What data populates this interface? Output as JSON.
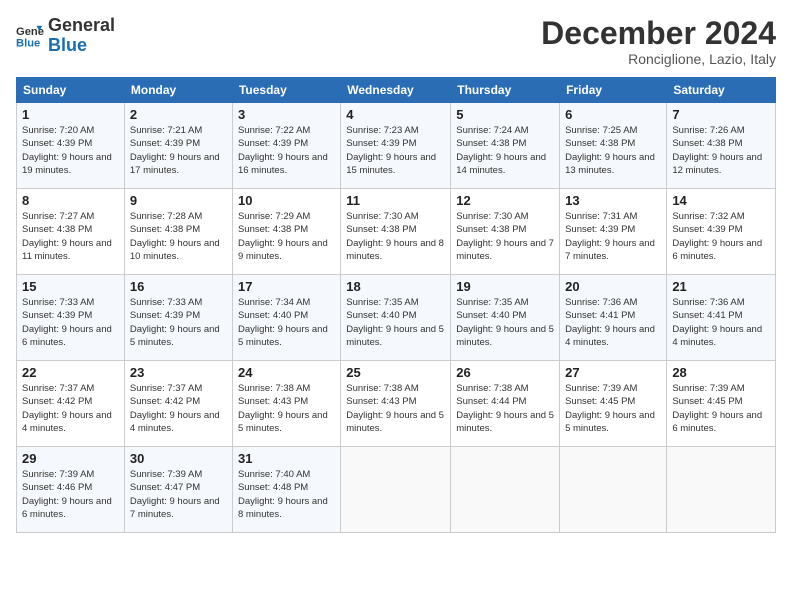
{
  "logo": {
    "line1": "General",
    "line2": "Blue"
  },
  "title": "December 2024",
  "location": "Ronciglione, Lazio, Italy",
  "days_header": [
    "Sunday",
    "Monday",
    "Tuesday",
    "Wednesday",
    "Thursday",
    "Friday",
    "Saturday"
  ],
  "weeks": [
    [
      {
        "day": "1",
        "sunrise": "7:20 AM",
        "sunset": "4:39 PM",
        "daylight": "9 hours and 19 minutes."
      },
      {
        "day": "2",
        "sunrise": "7:21 AM",
        "sunset": "4:39 PM",
        "daylight": "9 hours and 17 minutes."
      },
      {
        "day": "3",
        "sunrise": "7:22 AM",
        "sunset": "4:39 PM",
        "daylight": "9 hours and 16 minutes."
      },
      {
        "day": "4",
        "sunrise": "7:23 AM",
        "sunset": "4:39 PM",
        "daylight": "9 hours and 15 minutes."
      },
      {
        "day": "5",
        "sunrise": "7:24 AM",
        "sunset": "4:38 PM",
        "daylight": "9 hours and 14 minutes."
      },
      {
        "day": "6",
        "sunrise": "7:25 AM",
        "sunset": "4:38 PM",
        "daylight": "9 hours and 13 minutes."
      },
      {
        "day": "7",
        "sunrise": "7:26 AM",
        "sunset": "4:38 PM",
        "daylight": "9 hours and 12 minutes."
      }
    ],
    [
      {
        "day": "8",
        "sunrise": "7:27 AM",
        "sunset": "4:38 PM",
        "daylight": "9 hours and 11 minutes."
      },
      {
        "day": "9",
        "sunrise": "7:28 AM",
        "sunset": "4:38 PM",
        "daylight": "9 hours and 10 minutes."
      },
      {
        "day": "10",
        "sunrise": "7:29 AM",
        "sunset": "4:38 PM",
        "daylight": "9 hours and 9 minutes."
      },
      {
        "day": "11",
        "sunrise": "7:30 AM",
        "sunset": "4:38 PM",
        "daylight": "9 hours and 8 minutes."
      },
      {
        "day": "12",
        "sunrise": "7:30 AM",
        "sunset": "4:38 PM",
        "daylight": "9 hours and 7 minutes."
      },
      {
        "day": "13",
        "sunrise": "7:31 AM",
        "sunset": "4:39 PM",
        "daylight": "9 hours and 7 minutes."
      },
      {
        "day": "14",
        "sunrise": "7:32 AM",
        "sunset": "4:39 PM",
        "daylight": "9 hours and 6 minutes."
      }
    ],
    [
      {
        "day": "15",
        "sunrise": "7:33 AM",
        "sunset": "4:39 PM",
        "daylight": "9 hours and 6 minutes."
      },
      {
        "day": "16",
        "sunrise": "7:33 AM",
        "sunset": "4:39 PM",
        "daylight": "9 hours and 5 minutes."
      },
      {
        "day": "17",
        "sunrise": "7:34 AM",
        "sunset": "4:40 PM",
        "daylight": "9 hours and 5 minutes."
      },
      {
        "day": "18",
        "sunrise": "7:35 AM",
        "sunset": "4:40 PM",
        "daylight": "9 hours and 5 minutes."
      },
      {
        "day": "19",
        "sunrise": "7:35 AM",
        "sunset": "4:40 PM",
        "daylight": "9 hours and 5 minutes."
      },
      {
        "day": "20",
        "sunrise": "7:36 AM",
        "sunset": "4:41 PM",
        "daylight": "9 hours and 4 minutes."
      },
      {
        "day": "21",
        "sunrise": "7:36 AM",
        "sunset": "4:41 PM",
        "daylight": "9 hours and 4 minutes."
      }
    ],
    [
      {
        "day": "22",
        "sunrise": "7:37 AM",
        "sunset": "4:42 PM",
        "daylight": "9 hours and 4 minutes."
      },
      {
        "day": "23",
        "sunrise": "7:37 AM",
        "sunset": "4:42 PM",
        "daylight": "9 hours and 4 minutes."
      },
      {
        "day": "24",
        "sunrise": "7:38 AM",
        "sunset": "4:43 PM",
        "daylight": "9 hours and 5 minutes."
      },
      {
        "day": "25",
        "sunrise": "7:38 AM",
        "sunset": "4:43 PM",
        "daylight": "9 hours and 5 minutes."
      },
      {
        "day": "26",
        "sunrise": "7:38 AM",
        "sunset": "4:44 PM",
        "daylight": "9 hours and 5 minutes."
      },
      {
        "day": "27",
        "sunrise": "7:39 AM",
        "sunset": "4:45 PM",
        "daylight": "9 hours and 5 minutes."
      },
      {
        "day": "28",
        "sunrise": "7:39 AM",
        "sunset": "4:45 PM",
        "daylight": "9 hours and 6 minutes."
      }
    ],
    [
      {
        "day": "29",
        "sunrise": "7:39 AM",
        "sunset": "4:46 PM",
        "daylight": "9 hours and 6 minutes."
      },
      {
        "day": "30",
        "sunrise": "7:39 AM",
        "sunset": "4:47 PM",
        "daylight": "9 hours and 7 minutes."
      },
      {
        "day": "31",
        "sunrise": "7:40 AM",
        "sunset": "4:48 PM",
        "daylight": "9 hours and 8 minutes."
      },
      null,
      null,
      null,
      null
    ]
  ]
}
